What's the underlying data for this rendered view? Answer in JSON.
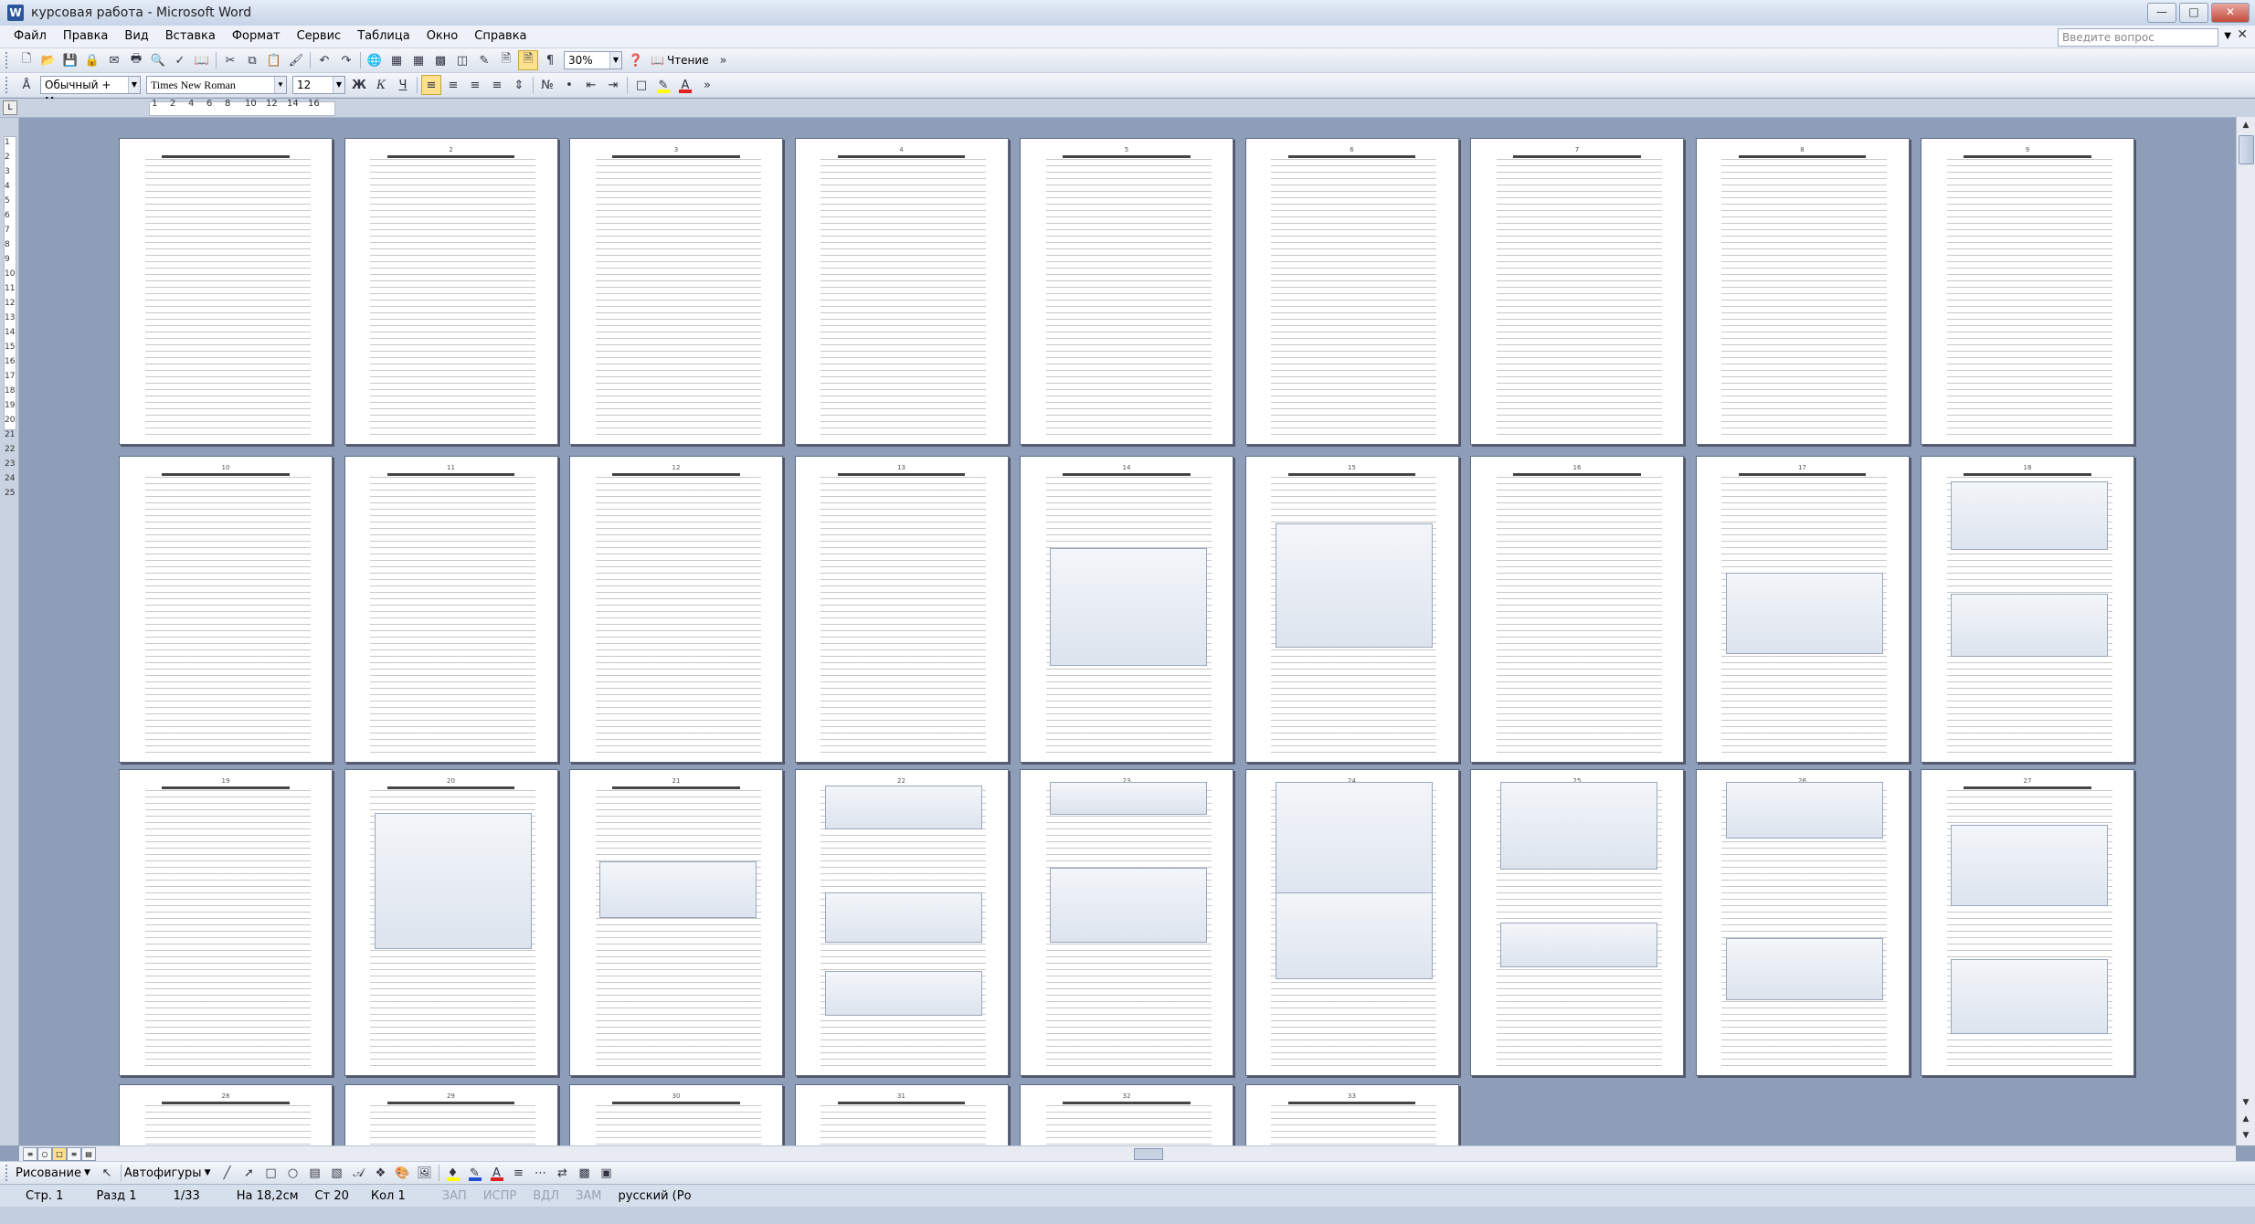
{
  "window": {
    "title": "курсовая работа - Microsoft Word",
    "app_icon": "W"
  },
  "menu": [
    "Файл",
    "Правка",
    "Вид",
    "Вставка",
    "Формат",
    "Сервис",
    "Таблица",
    "Окно",
    "Справка"
  ],
  "ask_box": {
    "placeholder": "Введите вопрос"
  },
  "toolbar_standard": {
    "zoom": "30%",
    "reading_label": "Чтение"
  },
  "toolbar_format": {
    "style": "Обычный + Межд",
    "font": "Times New Roman",
    "size": "12",
    "bold": "Ж",
    "italic": "К",
    "underline": "Ч"
  },
  "ruler": {
    "h_numbers": [
      "1",
      "2",
      "4",
      "6",
      "8",
      "10",
      "12",
      "14",
      "16"
    ],
    "v_numbers": [
      "1",
      "2",
      "3",
      "4",
      "5",
      "6",
      "7",
      "8",
      "9",
      "10",
      "11",
      "12",
      "13",
      "14",
      "15",
      "16",
      "17",
      "18",
      "19",
      "20",
      "21",
      "22",
      "23",
      "24",
      "25"
    ]
  },
  "pages": {
    "rows": 4,
    "cols": 9,
    "total": 33,
    "visible_count": 33
  },
  "drawing_toolbar": {
    "draw_label": "Рисование",
    "autoshapes_label": "Автофигуры"
  },
  "status": {
    "page": "Стр. 1",
    "section": "Разд 1",
    "of": "1/33",
    "position": "На 18,2см",
    "line": "Ст 20",
    "col": "Кол 1",
    "rec": "ЗАП",
    "trk": "ИСПР",
    "ext": "ВДЛ",
    "ovr": "ЗАМ",
    "lang": "русский (Ро"
  },
  "colors": {
    "chrome": "#D6DFEC",
    "workspace": "#8F9EB8",
    "highlight": "#FBE08E"
  }
}
